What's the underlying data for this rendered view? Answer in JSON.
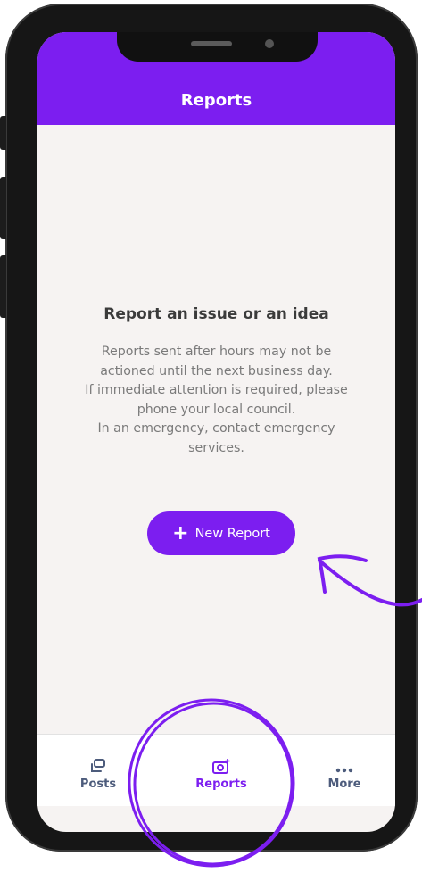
{
  "header": {
    "title": "Reports"
  },
  "empty_state": {
    "heading": "Report an issue or an idea",
    "lines": [
      "Reports sent after hours may not be",
      "actioned until the next business day.",
      "If immediate attention is required, please",
      "phone your local council.",
      "In an emergency, contact emergency",
      "services."
    ],
    "button_label": "New Report"
  },
  "bottom_nav": {
    "items": [
      {
        "label": "Posts",
        "icon": "posts-icon",
        "active": false
      },
      {
        "label": "Reports",
        "icon": "camera-plus-icon",
        "active": true
      },
      {
        "label": "More",
        "icon": "more-dots-icon",
        "active": false
      }
    ]
  },
  "colors": {
    "accent": "#7c1ef0",
    "nav_inactive": "#4d5c7c",
    "background": "#f6f3f2"
  }
}
